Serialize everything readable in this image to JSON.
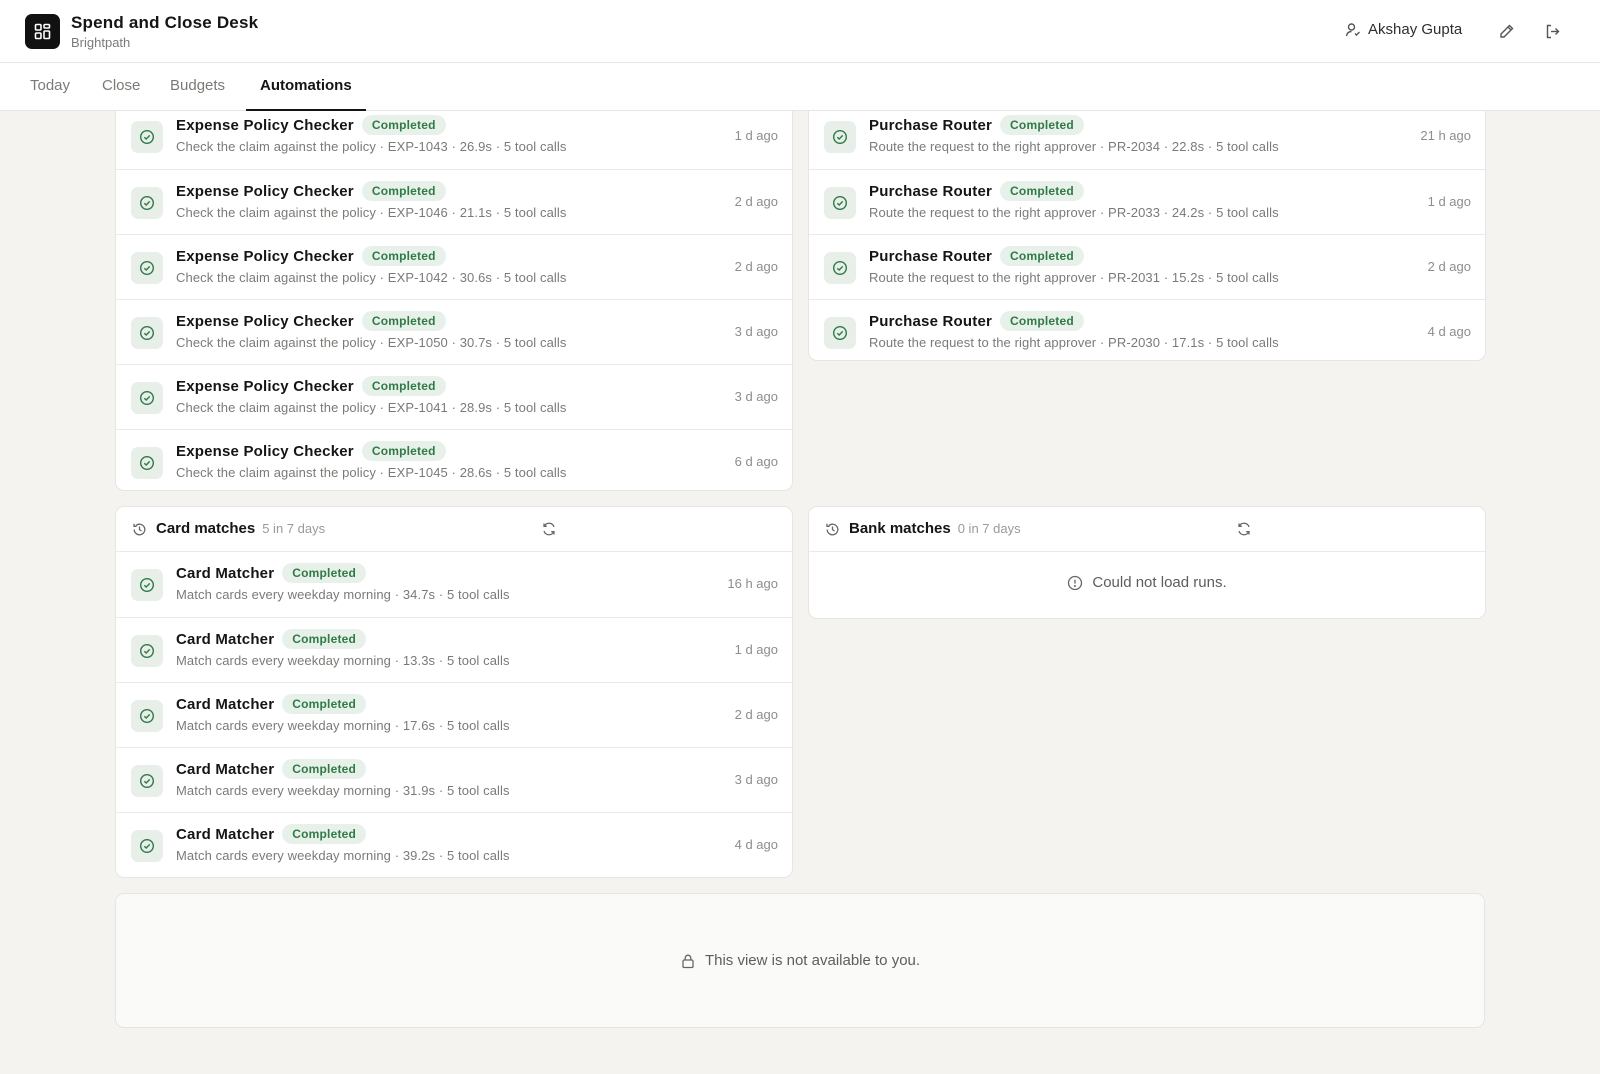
{
  "header": {
    "app_title": "Spend and Close Desk",
    "app_subtitle": "Brightpath",
    "user_name": "Akshay Gupta",
    "logo_icon": "grid-icon",
    "edit_icon": "pencil-icon",
    "logout_icon": "logout-icon"
  },
  "tabs": [
    {
      "label": "Today",
      "active": false
    },
    {
      "label": "Close",
      "active": false
    },
    {
      "label": "Budgets",
      "active": false
    },
    {
      "label": "Automations",
      "active": true
    }
  ],
  "status_label": "Completed",
  "colors": {
    "accent": "#151515",
    "badge_bg": "#e8f1e9",
    "badge_text": "#2f7a46",
    "page_bg": "#f4f3f0"
  },
  "expense_runs": [
    {
      "name": "Expense Policy Checker",
      "desc": "Check the claim against the policy · EXP-1043 · 26.9s · 5 tool calls",
      "time": "1 d ago"
    },
    {
      "name": "Expense Policy Checker",
      "desc": "Check the claim against the policy · EXP-1046 · 21.1s · 5 tool calls",
      "time": "2 d ago"
    },
    {
      "name": "Expense Policy Checker",
      "desc": "Check the claim against the policy · EXP-1042 · 30.6s · 5 tool calls",
      "time": "2 d ago"
    },
    {
      "name": "Expense Policy Checker",
      "desc": "Check the claim against the policy · EXP-1050 · 30.7s · 5 tool calls",
      "time": "3 d ago"
    },
    {
      "name": "Expense Policy Checker",
      "desc": "Check the claim against the policy · EXP-1041 · 28.9s · 5 tool calls",
      "time": "3 d ago"
    },
    {
      "name": "Expense Policy Checker",
      "desc": "Check the claim against the policy · EXP-1045 · 28.6s · 5 tool calls",
      "time": "6 d ago"
    }
  ],
  "purchase_runs": [
    {
      "name": "Purchase Router",
      "desc": "Route the request to the right approver · PR-2034 · 22.8s · 5 tool calls",
      "time": "21 h ago"
    },
    {
      "name": "Purchase Router",
      "desc": "Route the request to the right approver · PR-2033 · 24.2s · 5 tool calls",
      "time": "1 d ago"
    },
    {
      "name": "Purchase Router",
      "desc": "Route the request to the right approver · PR-2031 · 15.2s · 5 tool calls",
      "time": "2 d ago"
    },
    {
      "name": "Purchase Router",
      "desc": "Route the request to the right approver · PR-2030 · 17.1s · 5 tool calls",
      "time": "4 d ago"
    }
  ],
  "card_panel": {
    "title": "Card matches",
    "count": "5 in 7 days",
    "runs": [
      {
        "name": "Card Matcher",
        "desc": "Match cards every weekday morning · 34.7s · 5 tool calls",
        "time": "16 h ago"
      },
      {
        "name": "Card Matcher",
        "desc": "Match cards every weekday morning · 13.3s · 5 tool calls",
        "time": "1 d ago"
      },
      {
        "name": "Card Matcher",
        "desc": "Match cards every weekday morning · 17.6s · 5 tool calls",
        "time": "2 d ago"
      },
      {
        "name": "Card Matcher",
        "desc": "Match cards every weekday morning · 31.9s · 5 tool calls",
        "time": "3 d ago"
      },
      {
        "name": "Card Matcher",
        "desc": "Match cards every weekday morning · 39.2s · 5 tool calls",
        "time": "4 d ago"
      }
    ]
  },
  "bank_panel": {
    "title": "Bank matches",
    "count": "0 in 7 days",
    "error": "Could not load runs."
  },
  "locked_message": "This view is not available to you."
}
